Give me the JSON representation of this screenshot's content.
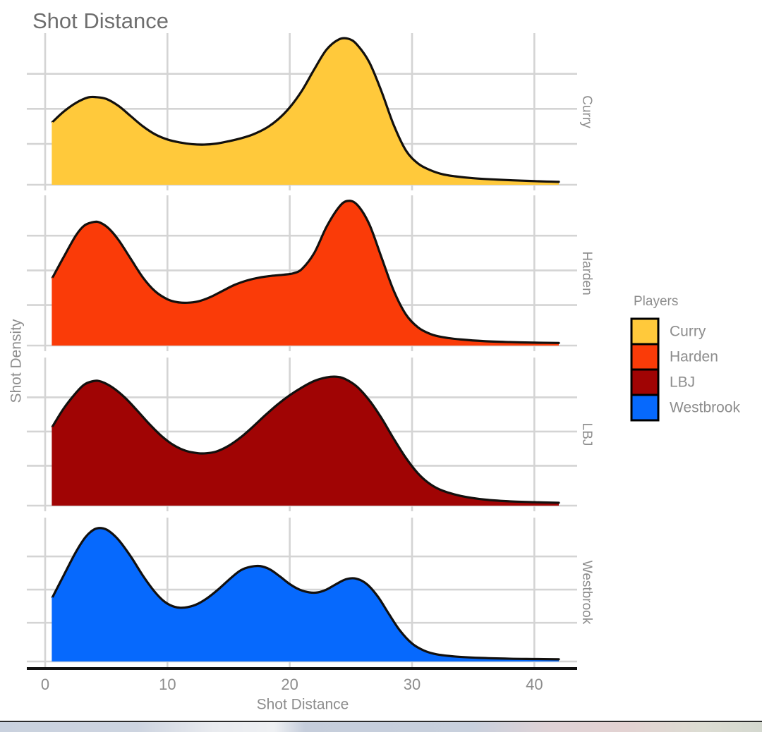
{
  "chart_data": {
    "type": "area",
    "title": "Shot Distance",
    "xlabel": "Shot Distance",
    "ylabel": "Shot Density",
    "subtitle": "",
    "grid": true,
    "legend_position": "right",
    "legend_title": "Players",
    "facet_variable": "Players",
    "facet_direction": "vertical",
    "xlim": [
      -1.5,
      43.5
    ],
    "xticks": [
      0,
      10,
      20,
      30,
      40
    ],
    "xtick_labels": [
      "0",
      "10",
      "20",
      "30",
      "40"
    ],
    "ylim": [
      0,
      1.0
    ],
    "ytick_labels": [],
    "notes": "Ridge/faceted kernel density estimate of shot distance (feet) per player; y axis unlabeled ticks",
    "series": [
      {
        "name": "Curry",
        "color": "#FFC93B",
        "facet_label": "Curry",
        "x": [
          0.6,
          1.5,
          2.5,
          3.5,
          4.2,
          5.0,
          6.0,
          7.0,
          8.0,
          9.0,
          10.0,
          11.0,
          12.0,
          13.0,
          14.0,
          15.0,
          16.0,
          17.0,
          18.0,
          19.0,
          20.0,
          21.0,
          22.0,
          23.0,
          24.0,
          24.8,
          25.5,
          26.5,
          27.5,
          28.5,
          29.5,
          30.5,
          31.5,
          32.5,
          33.5,
          35.0,
          37.0,
          39.0,
          41.0,
          42.0
        ],
        "y": [
          0.43,
          0.5,
          0.56,
          0.598,
          0.6,
          0.588,
          0.54,
          0.47,
          0.4,
          0.345,
          0.31,
          0.29,
          0.278,
          0.275,
          0.282,
          0.298,
          0.318,
          0.345,
          0.385,
          0.445,
          0.53,
          0.645,
          0.79,
          0.925,
          0.995,
          1.0,
          0.96,
          0.84,
          0.64,
          0.41,
          0.235,
          0.145,
          0.1,
          0.072,
          0.058,
          0.045,
          0.035,
          0.028,
          0.022,
          0.02
        ]
      },
      {
        "name": "Harden",
        "color": "#FA3B08",
        "facet_label": "Harden",
        "x": [
          0.6,
          1.5,
          2.5,
          3.2,
          4.0,
          4.5,
          5.2,
          6.0,
          7.0,
          8.0,
          9.0,
          10.0,
          10.8,
          11.6,
          12.5,
          13.5,
          14.5,
          15.5,
          16.5,
          17.5,
          18.5,
          19.5,
          20.3,
          21.0,
          22.0,
          23.0,
          24.0,
          24.7,
          25.5,
          26.5,
          27.5,
          28.5,
          29.5,
          30.5,
          31.5,
          32.5,
          34.0,
          36.0,
          38.0,
          40.0,
          42.0
        ],
        "y": [
          0.47,
          0.61,
          0.76,
          0.83,
          0.855,
          0.85,
          0.81,
          0.73,
          0.6,
          0.47,
          0.375,
          0.32,
          0.3,
          0.296,
          0.305,
          0.335,
          0.378,
          0.42,
          0.45,
          0.47,
          0.482,
          0.49,
          0.5,
          0.53,
          0.64,
          0.82,
          0.955,
          1.0,
          0.975,
          0.84,
          0.61,
          0.38,
          0.215,
          0.125,
          0.08,
          0.058,
          0.042,
          0.03,
          0.024,
          0.02,
          0.018
        ]
      },
      {
        "name": "LBJ",
        "color": "#A00404",
        "facet_label": "LBJ",
        "x": [
          0.6,
          1.5,
          2.5,
          3.2,
          4.0,
          4.6,
          5.5,
          6.5,
          7.5,
          8.5,
          9.5,
          10.5,
          11.5,
          12.5,
          13.2,
          14.0,
          15.0,
          16.0,
          17.0,
          18.0,
          19.0,
          20.0,
          21.0,
          22.0,
          23.0,
          23.8,
          24.5,
          25.5,
          26.5,
          27.5,
          28.5,
          29.5,
          30.5,
          31.5,
          32.5,
          34.0,
          36.0,
          38.0,
          40.0,
          42.0
        ],
        "y": [
          0.555,
          0.68,
          0.79,
          0.85,
          0.875,
          0.87,
          0.83,
          0.76,
          0.67,
          0.575,
          0.49,
          0.425,
          0.385,
          0.368,
          0.368,
          0.38,
          0.42,
          0.48,
          0.555,
          0.635,
          0.71,
          0.775,
          0.83,
          0.875,
          0.9,
          0.905,
          0.89,
          0.835,
          0.74,
          0.615,
          0.47,
          0.335,
          0.225,
          0.15,
          0.105,
          0.068,
          0.042,
          0.03,
          0.024,
          0.02
        ]
      },
      {
        "name": "Westbrook",
        "color": "#0669FD",
        "facet_label": "Westbrook",
        "x": [
          0.6,
          1.5,
          2.5,
          3.3,
          4.0,
          4.6,
          5.2,
          6.0,
          7.0,
          8.0,
          9.0,
          9.8,
          10.6,
          11.4,
          12.3,
          13.2,
          14.2,
          15.2,
          16.0,
          16.8,
          17.6,
          18.4,
          19.2,
          20.0,
          20.8,
          21.6,
          22.3,
          23.0,
          23.8,
          24.6,
          25.4,
          26.3,
          27.2,
          28.1,
          29.0,
          30.0,
          31.0,
          32.0,
          33.5,
          35.5,
          38.0,
          40.0,
          42.0
        ],
        "y": [
          0.465,
          0.62,
          0.79,
          0.9,
          0.955,
          0.965,
          0.945,
          0.88,
          0.76,
          0.62,
          0.5,
          0.43,
          0.395,
          0.39,
          0.41,
          0.455,
          0.525,
          0.605,
          0.66,
          0.685,
          0.69,
          0.665,
          0.615,
          0.56,
          0.52,
          0.5,
          0.5,
          0.52,
          0.56,
          0.595,
          0.6,
          0.56,
          0.47,
          0.345,
          0.225,
          0.13,
          0.078,
          0.052,
          0.036,
          0.026,
          0.02,
          0.018,
          0.016
        ]
      }
    ]
  },
  "header": {
    "title": "Shot Distance"
  },
  "axes": {
    "x_title": "Shot Distance",
    "y_title": "Shot Density",
    "x_tick_labels": [
      "0",
      "10",
      "20",
      "30",
      "40"
    ]
  },
  "facets": {
    "labels": [
      "Curry",
      "Harden",
      "LBJ",
      "Westbrook"
    ]
  },
  "legend": {
    "title": "Players",
    "items": [
      {
        "label": "Curry",
        "color": "#FFC93B"
      },
      {
        "label": "Harden",
        "color": "#FA3B08"
      },
      {
        "label": "LBJ",
        "color": "#A00404"
      },
      {
        "label": "Westbrook",
        "color": "#0669FD"
      }
    ]
  },
  "colors": {
    "title_gray": "#6e6e6e",
    "label_gray": "#8d8d8d",
    "gridline": "#d4d4d4",
    "axis_line": "#111111",
    "panel_bg": "#ffffff"
  }
}
